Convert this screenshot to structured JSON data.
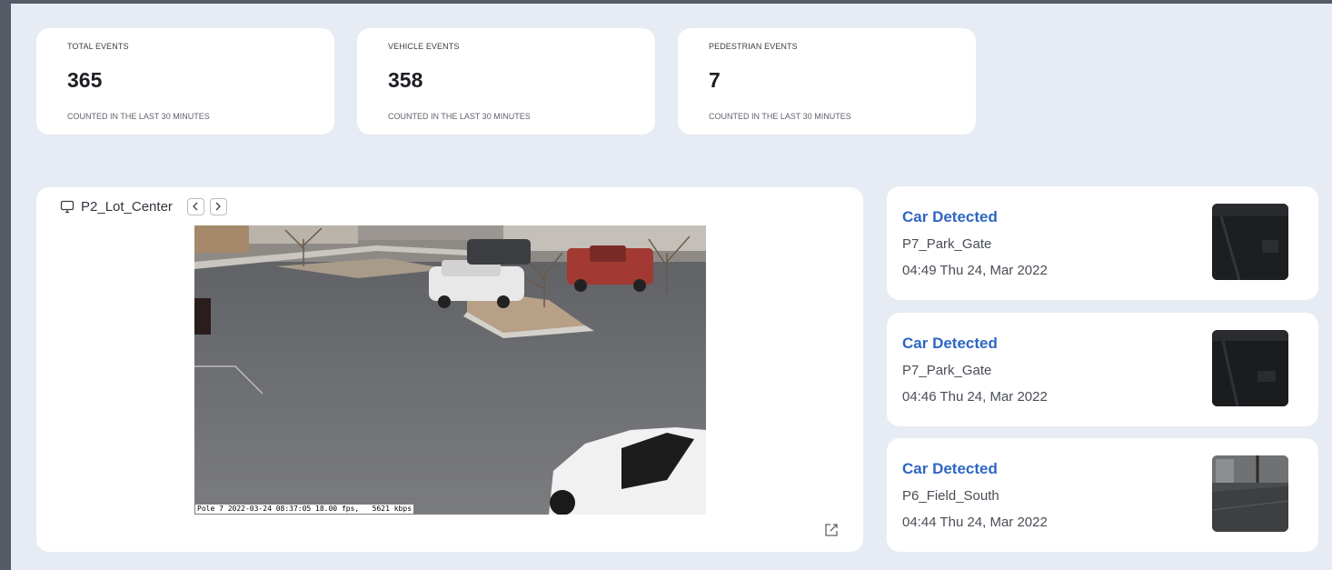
{
  "stats": [
    {
      "label": "TOTAL EVENTS",
      "value": "365",
      "sub": "COUNTED IN THE LAST 30 MINUTES"
    },
    {
      "label": "VEHICLE EVENTS",
      "value": "358",
      "sub": "COUNTED IN THE LAST 30 MINUTES"
    },
    {
      "label": "PEDESTRIAN EVENTS",
      "value": "7",
      "sub": "COUNTED IN THE LAST 30 MINUTES"
    }
  ],
  "camera": {
    "name": "P2_Lot_Center",
    "overlay": "Pole 7 2022-03-24 08:37:05 18.00 fps,   5621 kbps",
    "icons": {
      "camera": "monitor-icon",
      "prev": "chevron-left-icon",
      "next": "chevron-right-icon",
      "open": "external-link-icon"
    }
  },
  "events": [
    {
      "title": "Car Detected",
      "camera": "P7_Park_Gate",
      "time": "04:49 Thu 24, Mar 2022"
    },
    {
      "title": "Car Detected",
      "camera": "P7_Park_Gate",
      "time": "04:46 Thu 24, Mar 2022"
    },
    {
      "title": "Car Detected",
      "camera": "P6_Field_South",
      "time": "04:44 Thu 24, Mar 2022"
    }
  ],
  "colors": {
    "accent": "#2f66c4",
    "background": "#e7ebf3",
    "card": "#ffffff"
  }
}
